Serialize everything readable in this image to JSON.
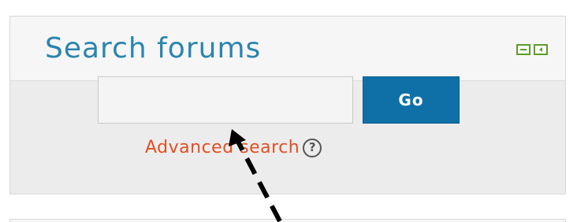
{
  "block": {
    "title": "Search forums",
    "controls": {
      "hide_icon": "minus-square-icon",
      "dock_icon": "dock-left-icon",
      "color": "#5d9c27"
    }
  },
  "search": {
    "value": "",
    "placeholder": "",
    "go_label": "Go",
    "advanced_label": "Advanced search",
    "help_icon_glyph": "?"
  },
  "colors": {
    "title": "#2a85ad",
    "button": "#0e70a6",
    "link": "#e04f22"
  }
}
